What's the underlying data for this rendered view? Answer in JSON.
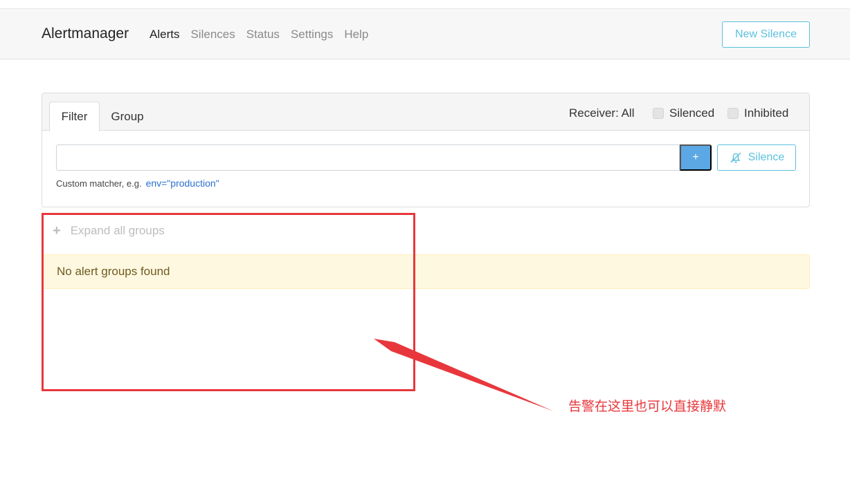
{
  "navbar": {
    "brand": "Alertmanager",
    "links": [
      {
        "label": "Alerts",
        "active": true
      },
      {
        "label": "Silences",
        "active": false
      },
      {
        "label": "Status",
        "active": false
      },
      {
        "label": "Settings",
        "active": false
      },
      {
        "label": "Help",
        "active": false
      }
    ],
    "new_silence_label": "New Silence"
  },
  "filter_card": {
    "tabs": [
      {
        "label": "Filter",
        "active": true
      },
      {
        "label": "Group",
        "active": false
      }
    ],
    "receiver_label": "Receiver: All",
    "checkboxes": [
      {
        "label": "Silenced",
        "checked": false
      },
      {
        "label": "Inhibited",
        "checked": false
      }
    ],
    "matcher_input": {
      "value": "",
      "placeholder": ""
    },
    "add_button_label": "+",
    "silence_button_label": "Silence",
    "silence_button_icon": "bell-slash-icon",
    "helper_text": "Custom matcher, e.g.",
    "helper_example": "env=\"production\""
  },
  "groups": {
    "expand_label": "Expand all groups",
    "expand_icon": "plus-icon",
    "empty_message": "No alert groups found"
  },
  "annotation": {
    "text": "告警在这里也可以直接静默",
    "color": "#e8373c"
  },
  "colors": {
    "info": "#5bc0de",
    "primary": "#5ba8e5",
    "warning_bg": "#fff8e1",
    "annotation": "#e8373c"
  }
}
